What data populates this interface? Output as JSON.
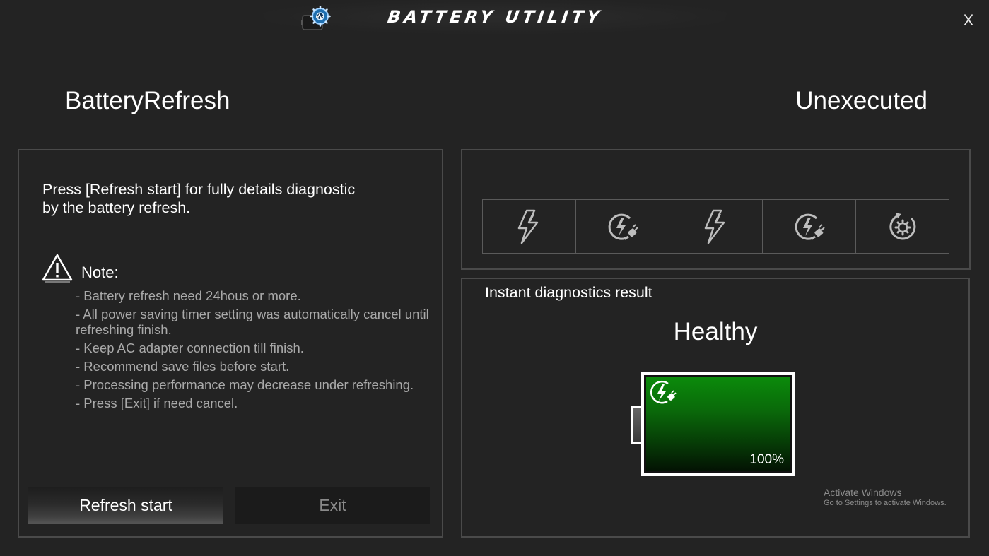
{
  "header": {
    "app_title": "BATTERY UTILITY",
    "app_icon": "battery-gear-icon",
    "close_label": "X"
  },
  "page": {
    "feature_title": "BatteryRefresh",
    "execution_status": "Unexecuted"
  },
  "left_panel": {
    "intro_line1": "Press [Refresh start] for fully details diagnostic",
    "intro_line2": "by the battery refresh.",
    "note_label": "Note:",
    "note_icon": "warning-triangle-icon",
    "notes": [
      "- Battery refresh need 24hous or more.",
      "- All power saving timer setting was automatically cancel until refreshing finish.",
      "- Keep AC adapter connection till finish.",
      "- Recommend save files before start.",
      "- Processing performance may decrease under refreshing.",
      "- Press [Exit] if need  cancel."
    ],
    "start_button": "Refresh start",
    "exit_button": "Exit"
  },
  "steps": {
    "icons": [
      "lightning-icon",
      "ac-charge-icon",
      "lightning-icon",
      "ac-charge-icon",
      "refresh-gear-icon"
    ]
  },
  "result": {
    "title": "Instant diagnostics result",
    "health": "Healthy",
    "battery_percent": "100%",
    "battery_level": 1.0,
    "battery_icon": "ac-charge-icon",
    "fill_color": "#0a7a0a"
  },
  "watermark": {
    "title": "Activate Windows",
    "subtitle": "Go to Settings to activate Windows."
  }
}
